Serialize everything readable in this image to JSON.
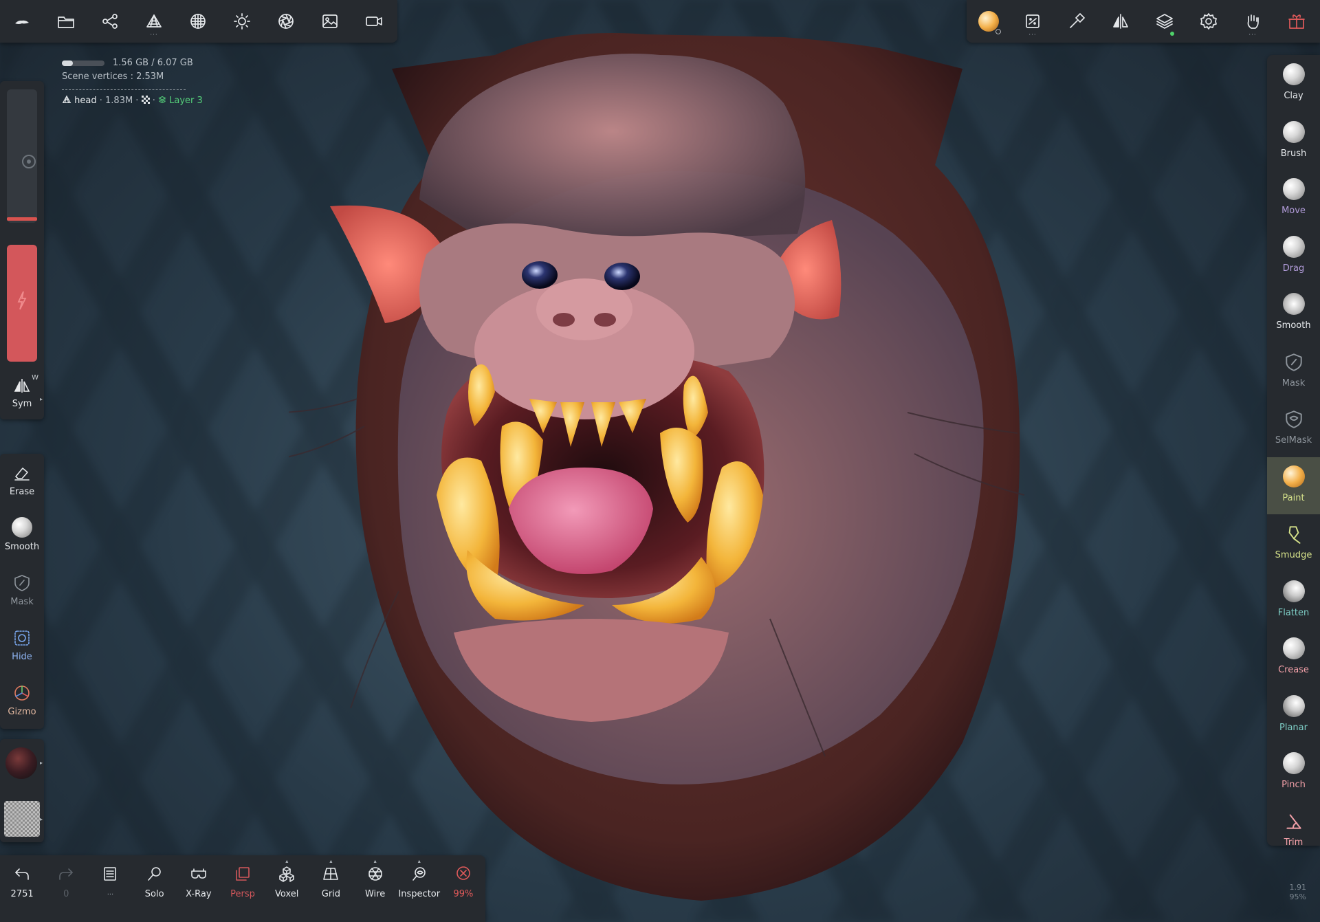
{
  "colors": {
    "panel_bg": "#262a2f",
    "accent_red": "#d3575b",
    "active_green_text": "#d6e28a",
    "layer_green": "#55d07a",
    "fps_text": "#7c8790"
  },
  "top_toolbar_left": [
    {
      "icon": "nomad-logo-icon"
    },
    {
      "icon": "folder-icon"
    },
    {
      "icon": "scene-graph-icon"
    },
    {
      "icon": "topology-icon"
    },
    {
      "icon": "material-sphere-icon"
    },
    {
      "icon": "light-icon"
    },
    {
      "icon": "aperture-icon"
    },
    {
      "icon": "image-icon"
    },
    {
      "icon": "video-camera-icon"
    }
  ],
  "top_toolbar_right": [
    {
      "icon": "paint-material-icon"
    },
    {
      "icon": "canvas-icon"
    },
    {
      "icon": "hammer-icon"
    },
    {
      "icon": "symmetry-icon"
    },
    {
      "icon": "layers-icon"
    },
    {
      "icon": "settings-gear-icon"
    },
    {
      "icon": "gesture-hand-icon"
    },
    {
      "icon": "gift-icon"
    }
  ],
  "info": {
    "memory": "1.56 GB / 6.07 GB",
    "memory_fraction": 0.26,
    "scene_vertices_label": "Scene vertices :",
    "scene_vertices_value": "2.53M",
    "object_name": "head",
    "object_vertices": "· 1.83M ·",
    "layer_name": "Layer 3"
  },
  "left_panel": {
    "sym_label": "Sym",
    "sym_hotkey": "W",
    "tools": [
      {
        "label": "Erase"
      },
      {
        "label": "Smooth"
      },
      {
        "label": "Mask"
      },
      {
        "label": "Hide"
      },
      {
        "label": "Gizmo"
      }
    ]
  },
  "right_tools": [
    {
      "label": "Clay",
      "color": "#e6e9ec"
    },
    {
      "label": "Brush",
      "color": "#e6e9ec"
    },
    {
      "label": "Move",
      "color": "#b39ddb"
    },
    {
      "label": "Drag",
      "color": "#b39ddb"
    },
    {
      "label": "Smooth",
      "color": "#e6e9ec"
    },
    {
      "label": "Mask",
      "color": "#8e959c"
    },
    {
      "label": "SelMask",
      "color": "#8e959c"
    },
    {
      "label": "Paint",
      "color": "#d6e28a"
    },
    {
      "label": "Smudge",
      "color": "#d6e28a"
    },
    {
      "label": "Flatten",
      "color": "#7fd0c8"
    },
    {
      "label": "Crease",
      "color": "#f2a0a8"
    },
    {
      "label": "Planar",
      "color": "#7fd0c8"
    },
    {
      "label": "Pinch",
      "color": "#f2a0a8"
    },
    {
      "label": "Trim",
      "color": "#f2a0a8"
    }
  ],
  "bottom_toolbar": [
    {
      "label": "2751",
      "icon": "undo-icon"
    },
    {
      "label": "0",
      "icon": "redo-icon"
    },
    {
      "label": "...",
      "icon": "list-icon"
    },
    {
      "label": "Solo",
      "icon": "search-icon"
    },
    {
      "label": "X-Ray",
      "icon": "xray-glasses-icon"
    },
    {
      "label": "Persp",
      "icon": "perspective-icon"
    },
    {
      "label": "Voxel",
      "icon": "voxel-icon"
    },
    {
      "label": "Grid",
      "icon": "grid-icon"
    },
    {
      "label": "Wire",
      "icon": "wireframe-icon"
    },
    {
      "label": "Inspector",
      "icon": "inspector-icon"
    },
    {
      "label": "99%",
      "icon": "close-circle-icon"
    }
  ],
  "fps": {
    "line1": "1.91",
    "line2": "95%"
  }
}
